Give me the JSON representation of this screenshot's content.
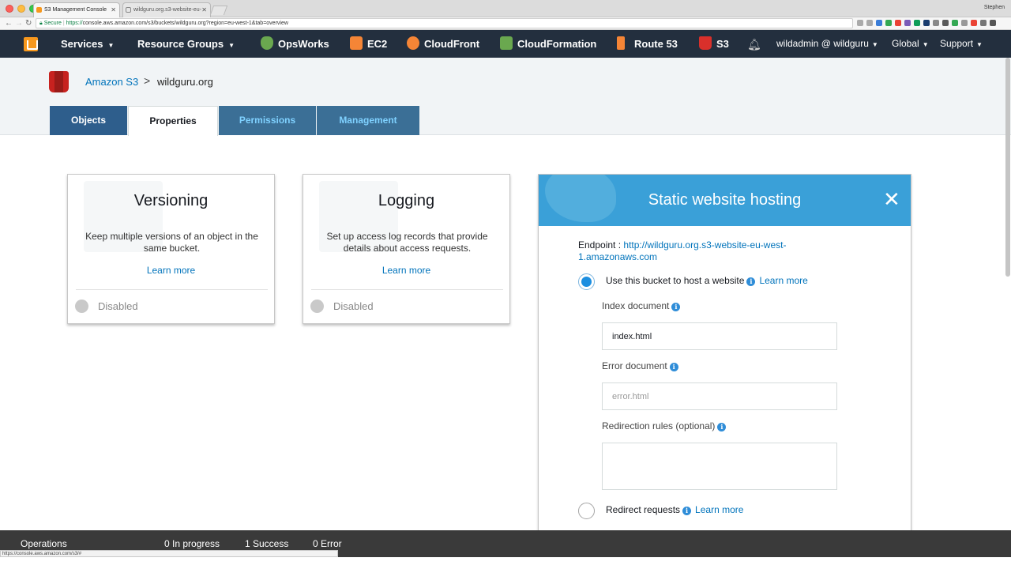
{
  "browser": {
    "tabs": [
      {
        "title": "S3 Management Console"
      },
      {
        "title": "wildguru.org.s3-website-eu-"
      }
    ],
    "profile": "Stephen",
    "secure_label": "Secure",
    "url_scheme": "https://",
    "url_rest": "console.aws.amazon.com/s3/buckets/wildguru.org?region=eu-west-1&tab=overview",
    "status_url": "https://console.aws.amazon.com/s3/#"
  },
  "nav": {
    "services": "Services",
    "resource_groups": "Resource Groups",
    "shortcuts": [
      {
        "label": "OpsWorks",
        "color": "#6aa84f"
      },
      {
        "label": "EC2",
        "color": "#f58536"
      },
      {
        "label": "CloudFront",
        "color": "#f58536"
      },
      {
        "label": "CloudFormation",
        "color": "#6aa84f"
      },
      {
        "label": "Route 53",
        "color": "#f58536"
      },
      {
        "label": "S3",
        "color": "#d9302b"
      }
    ],
    "account": "wildadmin @ wildguru",
    "region": "Global",
    "support": "Support"
  },
  "breadcrumb": {
    "root": "Amazon S3",
    "separator": ">",
    "current": "wildguru.org"
  },
  "tabs": {
    "objects": "Objects",
    "properties": "Properties",
    "permissions": "Permissions",
    "management": "Management"
  },
  "cards": {
    "versioning": {
      "title": "Versioning",
      "description": "Keep multiple versions of an object in the same bucket.",
      "learn_more": "Learn more",
      "status": "Disabled"
    },
    "logging": {
      "title": "Logging",
      "description": "Set up access log records that provide details about access requests.",
      "learn_more": "Learn more",
      "status": "Disabled"
    }
  },
  "hosting": {
    "title": "Static website hosting",
    "close_glyph": "✕",
    "endpoint_label": "Endpoint :",
    "endpoint_url": "http://wildguru.org.s3-website-eu-west-1.amazonaws.com",
    "use_bucket_label": "Use this bucket to host a website",
    "learn_more": "Learn more",
    "index_label": "Index document",
    "index_value": "index.html",
    "error_label": "Error document",
    "error_placeholder": "error.html",
    "redirection_label": "Redirection rules (optional)",
    "redirect_label": "Redirect requests",
    "info_glyph": "i"
  },
  "operations": {
    "label": "Operations",
    "in_progress": "0 In progress",
    "success": "1 Success",
    "error": "0 Error"
  },
  "colors": {
    "aws_nav": "#232f3e",
    "link": "#0073bb",
    "hosting_header": "#3aa0d8",
    "selected_tab": "#2e5e8c"
  }
}
